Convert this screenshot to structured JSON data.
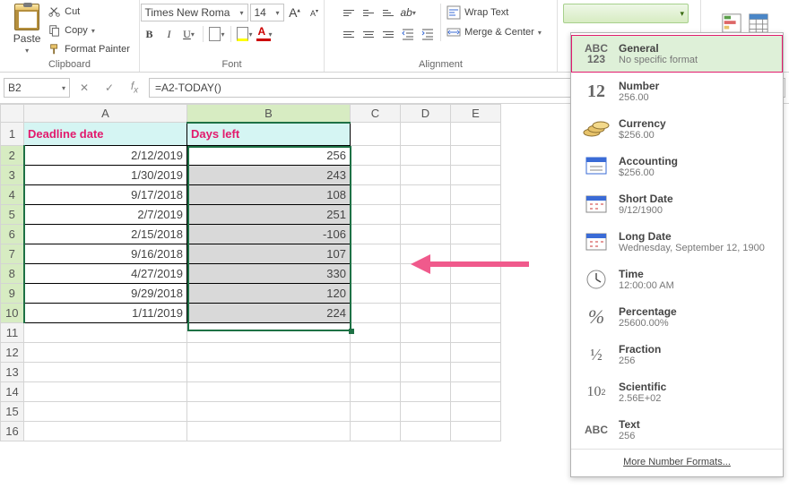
{
  "ribbon": {
    "clipboard": {
      "label": "Clipboard",
      "paste": "Paste",
      "cut": "Cut",
      "copy": "Copy",
      "format_painter": "Format Painter"
    },
    "font": {
      "label": "Font",
      "name": "Times New Roma",
      "size": "14"
    },
    "alignment": {
      "label": "Alignment",
      "wrap": "Wrap Text",
      "merge": "Merge & Center"
    }
  },
  "formula_bar": {
    "cell_ref": "B2",
    "formula": "=A2-TODAY()"
  },
  "columns": [
    "A",
    "B",
    "C",
    "D",
    "E"
  ],
  "headers": {
    "A": "Deadline date",
    "B": "Days left"
  },
  "rows": [
    {
      "n": "1"
    },
    {
      "n": "2",
      "A": "2/12/2019",
      "B": "256"
    },
    {
      "n": "3",
      "A": "1/30/2019",
      "B": "243"
    },
    {
      "n": "4",
      "A": "9/17/2018",
      "B": "108"
    },
    {
      "n": "5",
      "A": "2/7/2019",
      "B": "251"
    },
    {
      "n": "6",
      "A": "2/15/2018",
      "B": "-106"
    },
    {
      "n": "7",
      "A": "9/16/2018",
      "B": "107"
    },
    {
      "n": "8",
      "A": "4/27/2019",
      "B": "330"
    },
    {
      "n": "9",
      "A": "9/29/2018",
      "B": "120"
    },
    {
      "n": "10",
      "A": "1/11/2019",
      "B": "224"
    },
    {
      "n": "11"
    },
    {
      "n": "12"
    },
    {
      "n": "13"
    },
    {
      "n": "14"
    },
    {
      "n": "15"
    },
    {
      "n": "16"
    }
  ],
  "number_formats": {
    "items": [
      {
        "key": "general",
        "title": "General",
        "sub": "No specific format"
      },
      {
        "key": "number",
        "title": "Number",
        "sub": "256.00"
      },
      {
        "key": "currency",
        "title": "Currency",
        "sub": "$256.00"
      },
      {
        "key": "accounting",
        "title": "Accounting",
        "sub": "$256.00"
      },
      {
        "key": "shortdate",
        "title": "Short Date",
        "sub": "9/12/1900"
      },
      {
        "key": "longdate",
        "title": "Long Date",
        "sub": "Wednesday, September 12, 1900"
      },
      {
        "key": "time",
        "title": "Time",
        "sub": "12:00:00 AM"
      },
      {
        "key": "percentage",
        "title": "Percentage",
        "sub": "25600.00%"
      },
      {
        "key": "fraction",
        "title": "Fraction",
        "sub": "256"
      },
      {
        "key": "scientific",
        "title": "Scientific",
        "sub": "2.56E+02"
      },
      {
        "key": "text",
        "title": "Text",
        "sub": "256"
      }
    ],
    "more": "More Number Formats..."
  }
}
